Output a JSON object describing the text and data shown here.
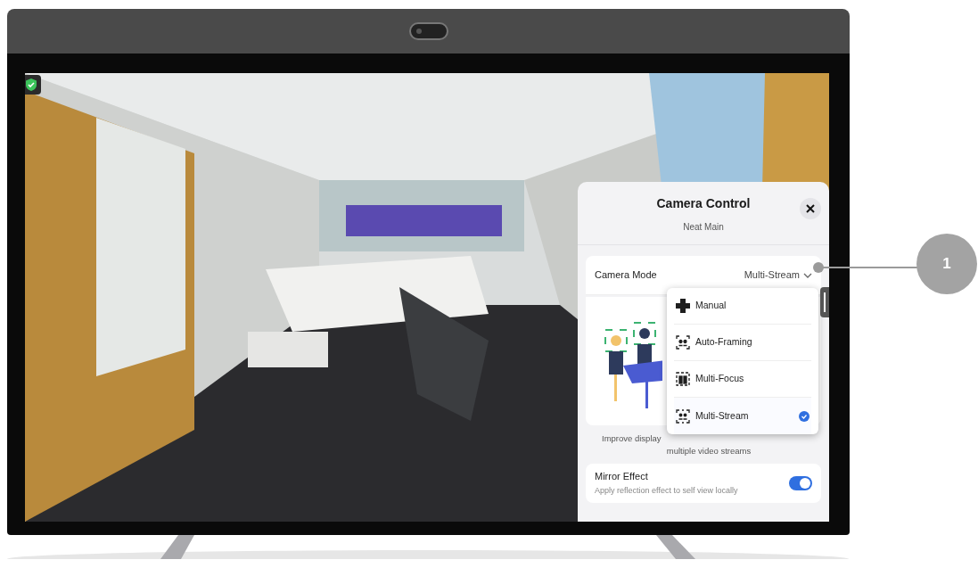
{
  "panel": {
    "title": "Camera Control",
    "subtitle": "Neat Main"
  },
  "camera_mode": {
    "label": "Camera Mode",
    "value": "Multi-Stream"
  },
  "mode_menu": [
    {
      "label": "Manual",
      "kind": "manual",
      "selected": false
    },
    {
      "label": "Auto-Framing",
      "kind": "autoframing",
      "selected": false
    },
    {
      "label": "Multi-Focus",
      "kind": "multifocus",
      "selected": false
    },
    {
      "label": "Multi-Stream",
      "kind": "multistream",
      "selected": true
    }
  ],
  "description": [
    "Improve display",
    "multiple video streams"
  ],
  "mirror_effect": {
    "title": "Mirror Effect",
    "description": "Apply reflection effect to self view locally",
    "on": true
  },
  "callout": "1"
}
